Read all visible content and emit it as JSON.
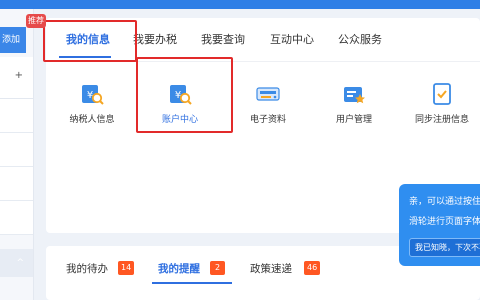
{
  "sidebar": {
    "top_label": "添加",
    "badge": "推荐",
    "plus": "+",
    "collapse": "^"
  },
  "main_tabs": [
    {
      "label": "我的信息",
      "active": true
    },
    {
      "label": "我要办税",
      "active": false
    },
    {
      "label": "我要查询",
      "active": false
    },
    {
      "label": "互动中心",
      "active": false
    },
    {
      "label": "公众服务",
      "active": false
    }
  ],
  "tiles": [
    {
      "label": "纳税人信息",
      "icon": "taxpayer-yen-search-icon",
      "highlighted": false
    },
    {
      "label": "账户中心",
      "icon": "account-yen-search-icon",
      "highlighted": true
    },
    {
      "label": "电子资料",
      "icon": "scanner-icon",
      "highlighted": false
    },
    {
      "label": "用户管理",
      "icon": "user-star-icon",
      "highlighted": false
    },
    {
      "label": "同步注册信息",
      "icon": "document-check-icon",
      "highlighted": false
    }
  ],
  "bottom_tabs": [
    {
      "label": "我的待办",
      "count": "14",
      "active": false
    },
    {
      "label": "我的提醒",
      "count": "2",
      "active": true
    },
    {
      "label": "政策速递",
      "count": "46",
      "active": false
    }
  ],
  "tooltip": {
    "line1": "亲，可以通过按住",
    "line2": "滑轮进行页面字体",
    "button": "我已知晓，下次不再提醒"
  },
  "colors": {
    "accent": "#2f6fe0",
    "highlight_box": "#e22a2a",
    "badge": "#ff5722",
    "tooltip_bg": "#2f8ef0"
  }
}
